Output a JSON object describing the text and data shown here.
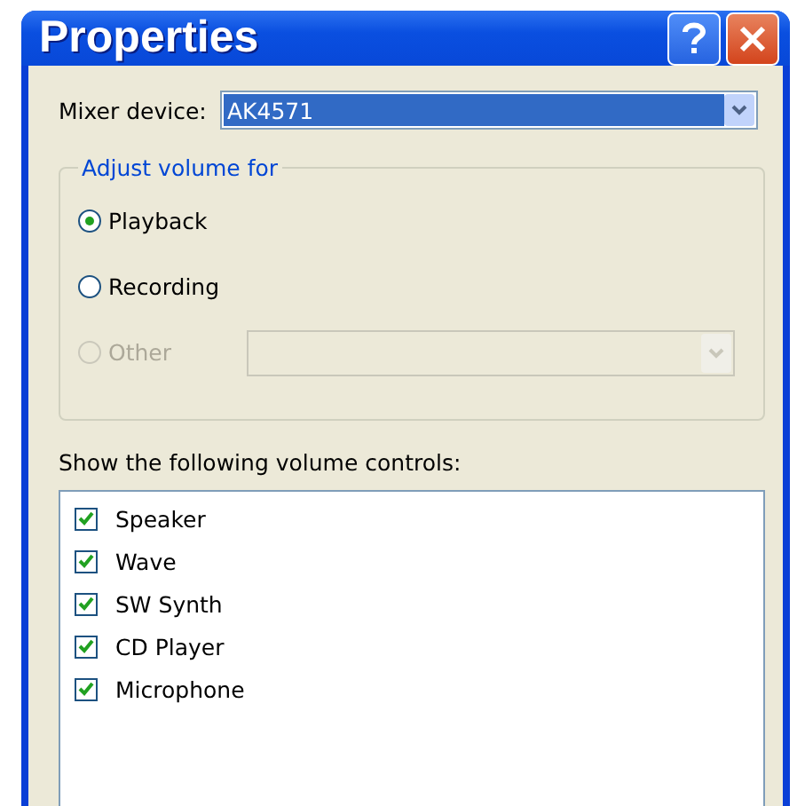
{
  "window": {
    "title": "Properties"
  },
  "mixer_device": {
    "label": "Mixer device:",
    "value": "AK4571"
  },
  "adjust_volume": {
    "title": "Adjust volume for",
    "options": [
      {
        "label": "Playback",
        "selected": true,
        "disabled": false
      },
      {
        "label": "Recording",
        "selected": false,
        "disabled": false
      },
      {
        "label": "Other",
        "selected": false,
        "disabled": true
      }
    ]
  },
  "controls_list": {
    "label": "Show the following volume controls:",
    "items": [
      {
        "label": "Speaker",
        "checked": true
      },
      {
        "label": "Wave",
        "checked": true
      },
      {
        "label": "SW Synth",
        "checked": true
      },
      {
        "label": "CD Player",
        "checked": true
      },
      {
        "label": "Microphone",
        "checked": true
      }
    ]
  }
}
